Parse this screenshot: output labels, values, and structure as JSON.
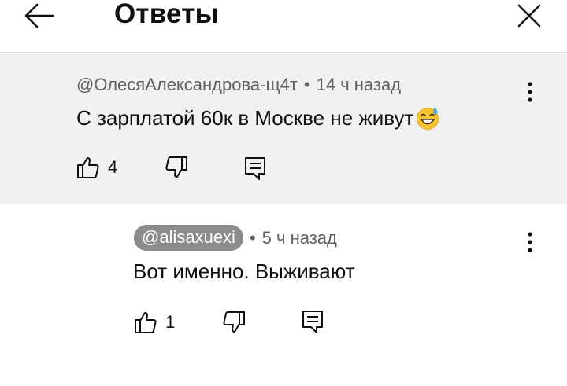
{
  "header": {
    "title": "Ответы",
    "back_icon": "arrow-left-icon",
    "close_icon": "close-icon"
  },
  "parent_comment": {
    "author": "@ОлесяАлександрова-щ4т",
    "separator": "•",
    "time": "14 ч назад",
    "text": "С зарплатой 60к в Москве не живут",
    "emoji": "grinning-face-with-sweat-icon",
    "like_count": "4",
    "background": "#f1f1f1"
  },
  "reply_comment": {
    "author": "@alisaxuexi",
    "separator": "•",
    "time": "5 ч назад",
    "text": "Вот именно. Выживают",
    "like_count": "1",
    "chip_color": "#8c8c8c"
  }
}
